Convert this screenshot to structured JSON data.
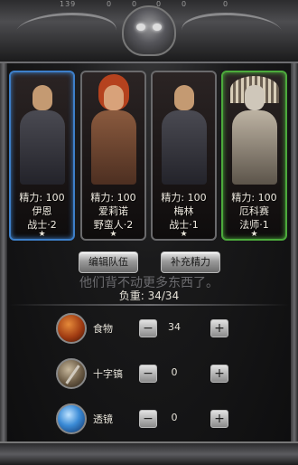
{
  "top_numbers": [
    "139",
    "0",
    "0",
    "0",
    "0",
    "0"
  ],
  "heroes": [
    {
      "stamina": "精力: 100",
      "name": "伊恩",
      "cls": "战士·2",
      "star": "★"
    },
    {
      "stamina": "精力: 100",
      "name": "爱莉诺",
      "cls": "野蛮人·2",
      "star": "★"
    },
    {
      "stamina": "精力: 100",
      "name": "梅林",
      "cls": "战士·1",
      "star": "★"
    },
    {
      "stamina": "精力: 100",
      "name": "厄科赛",
      "cls": "法师·1",
      "star": "★"
    }
  ],
  "buttons": {
    "edit": "编辑队伍",
    "refill": "补充精力"
  },
  "hint": "他们背不动更多东西了。",
  "load": "负重: 34/34",
  "items": [
    {
      "name": "食物",
      "qty": "34",
      "icon": "food-icon"
    },
    {
      "name": "十字镐",
      "qty": "0",
      "icon": "pickaxe-icon"
    },
    {
      "name": "透镜",
      "qty": "0",
      "icon": "lens-icon"
    }
  ],
  "stepper": {
    "minus": "−",
    "plus": "+"
  },
  "colors": {
    "selected_blue": "#3d7fc9",
    "selected_green": "#4caa3c"
  }
}
